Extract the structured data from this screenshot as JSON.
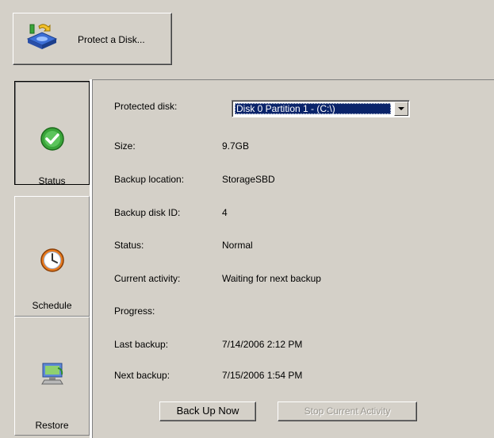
{
  "toolbar": {
    "protect_label": "Protect a Disk..."
  },
  "sidebar": {
    "tabs": [
      {
        "label": "Status",
        "icon": "check-icon"
      },
      {
        "label": "Schedule",
        "icon": "clock-icon"
      },
      {
        "label": "Restore",
        "icon": "restore-computer-icon"
      }
    ]
  },
  "details": {
    "protected_disk_label": "Protected disk:",
    "protected_disk_value": "Disk 0 Partition 1 - (C:\\)",
    "size_label": "Size:",
    "size_value": "9.7GB",
    "backup_location_label": "Backup location:",
    "backup_location_value": "StorageSBD",
    "backup_disk_id_label": "Backup disk ID:",
    "backup_disk_id_value": "4",
    "status_label": "Status:",
    "status_value": "Normal",
    "current_activity_label": "Current activity:",
    "current_activity_value": "Waiting for next backup",
    "progress_label": "Progress:",
    "last_backup_label": "Last backup:",
    "last_backup_value": "7/14/2006 2:12 PM",
    "next_backup_label": "Next backup:",
    "next_backup_value": "7/15/2006 1:54 PM"
  },
  "actions": {
    "backup_now_label": "Back Up Now",
    "stop_activity_label": "Stop Current Activity"
  },
  "colors": {
    "window_bg": "#d4d0c8",
    "selection": "#0a246a",
    "status_green": "#3aa53a",
    "clock_orange": "#e87a1e"
  }
}
